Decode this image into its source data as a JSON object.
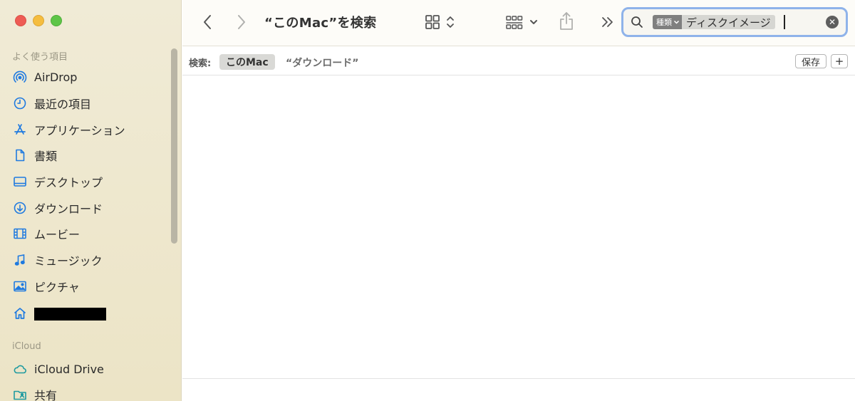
{
  "sidebar": {
    "favorites_label": "よく使う項目",
    "items": [
      {
        "label": "AirDrop",
        "icon": "airdrop-icon"
      },
      {
        "label": "最近の項目",
        "icon": "clock-icon"
      },
      {
        "label": "アプリケーション",
        "icon": "applications-icon"
      },
      {
        "label": "書類",
        "icon": "document-icon"
      },
      {
        "label": "デスクトップ",
        "icon": "desktop-icon"
      },
      {
        "label": "ダウンロード",
        "icon": "download-icon"
      },
      {
        "label": "ムービー",
        "icon": "film-icon"
      },
      {
        "label": "ミュージック",
        "icon": "music-icon"
      },
      {
        "label": "ピクチャ",
        "icon": "picture-icon"
      },
      {
        "label": "",
        "icon": "home-icon"
      }
    ],
    "icloud_label": "iCloud",
    "icloud_items": [
      {
        "label": "iCloud Drive",
        "icon": "cloud-icon"
      },
      {
        "label": "共有",
        "icon": "shared-folder-icon"
      }
    ]
  },
  "toolbar": {
    "title": "“このMac”を検索"
  },
  "search": {
    "token_label": "種類",
    "token_value": "ディスクイメージ"
  },
  "scope": {
    "label": "検索:",
    "current": "このMac",
    "alternate": "“ダウンロード”",
    "save_label": "保存",
    "add_label": "+"
  },
  "colors": {
    "accent": "#1f7ae0",
    "search_focus": "#8fb3ea",
    "sidebar_bg": "#ece4c6"
  }
}
